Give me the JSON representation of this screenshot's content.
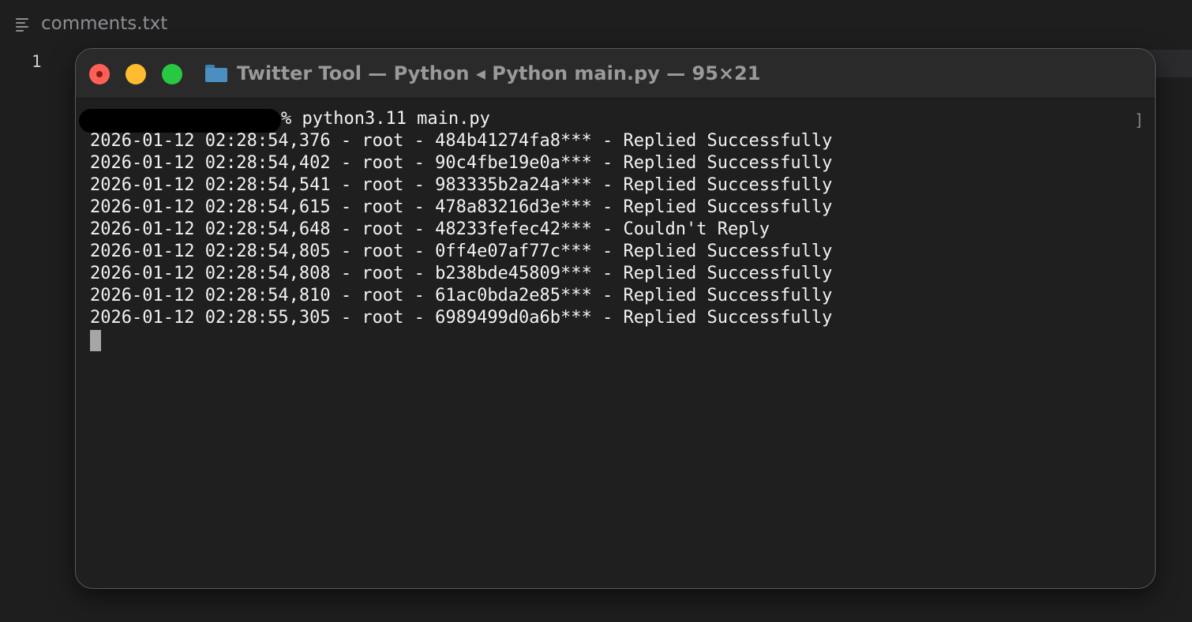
{
  "editor": {
    "file_name": "comments.txt",
    "line_number": "1"
  },
  "terminal": {
    "title": "Twitter Tool — Python ◂ Python main.py — 95×21",
    "command": "% python3.11 main.py",
    "scroll_marker": "]",
    "log_lines": [
      "2026-01-12 02:28:54,376 - root - 484b41274fa8*** - Replied Successfully",
      "2026-01-12 02:28:54,402 - root - 90c4fbe19e0a*** - Replied Successfully",
      "2026-01-12 02:28:54,541 - root - 983335b2a24a*** - Replied Successfully",
      "2026-01-12 02:28:54,615 - root - 478a83216d3e*** - Replied Successfully",
      "2026-01-12 02:28:54,648 - root - 48233fefec42*** - Couldn't Reply",
      "2026-01-12 02:28:54,805 - root - 0ff4e07af77c*** - Replied Successfully",
      "2026-01-12 02:28:54,808 - root - b238bde45809*** - Replied Successfully",
      "2026-01-12 02:28:54,810 - root - 61ac0bda2e85*** - Replied Successfully",
      "2026-01-12 02:28:55,305 - root - 6989499d0a6b*** - Replied Successfully"
    ]
  },
  "icons": {
    "file_icon": "text-lines-icon",
    "folder_icon": "folder-icon",
    "close": "close-dot-icon",
    "minimize": "minimize-dot-icon",
    "maximize": "maximize-dot-icon"
  },
  "colors": {
    "close": "#fe5f57",
    "minimize": "#febc2e",
    "maximize": "#28c840",
    "folder": "#4a8fc0"
  }
}
